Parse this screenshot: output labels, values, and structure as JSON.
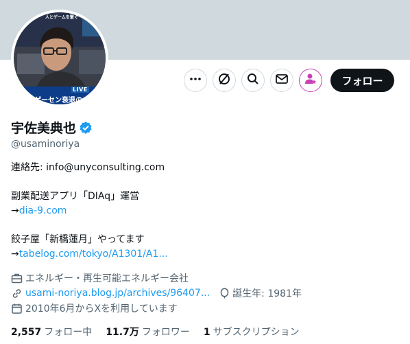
{
  "profile": {
    "name": "宇佐美典也",
    "handle": "@usaminoriya",
    "avatar_live_badge": "LIVE",
    "avatar_caption": "ゲーセン衰退の",
    "avatar_top_caption": "人とゲームを繋ぐ"
  },
  "actions": {
    "more_icon": "more-icon",
    "grok_icon": "grok-icon",
    "search_icon": "search-icon",
    "message_icon": "mail-icon",
    "subscribe_icon": "person-star-icon",
    "follow_label": "フォロー"
  },
  "bio": {
    "contact": "連絡先: info@unyconsulting.com",
    "line2": "副業配送アプリ「DIAq」運営",
    "arrow1": "→",
    "link1": "dia-9.com",
    "line4": "餃子屋「新橋蓮月」やってます",
    "arrow2": "→",
    "link2": "tabelog.com/tokyo/A1301/A1..."
  },
  "meta": {
    "category": "エネルギー・再生可能エネルギー会社",
    "website": "usami-noriya.blog.jp/archives/96407...",
    "birth": "誕生年: 1981年",
    "joined": "2010年6月からXを利用しています"
  },
  "stats": {
    "following_count": "2,557",
    "following_label": "フォロー中",
    "followers_count": "11.7万",
    "followers_label": "フォロワー",
    "subscriptions_count": "1",
    "subscriptions_label": "サブスクリプション"
  },
  "colors": {
    "banner": "#cfd9de",
    "link": "#1d9bf0",
    "verified": "#1d9bf0",
    "subscribe_accent": "#c940b6",
    "follow_button": "#0f1419"
  }
}
